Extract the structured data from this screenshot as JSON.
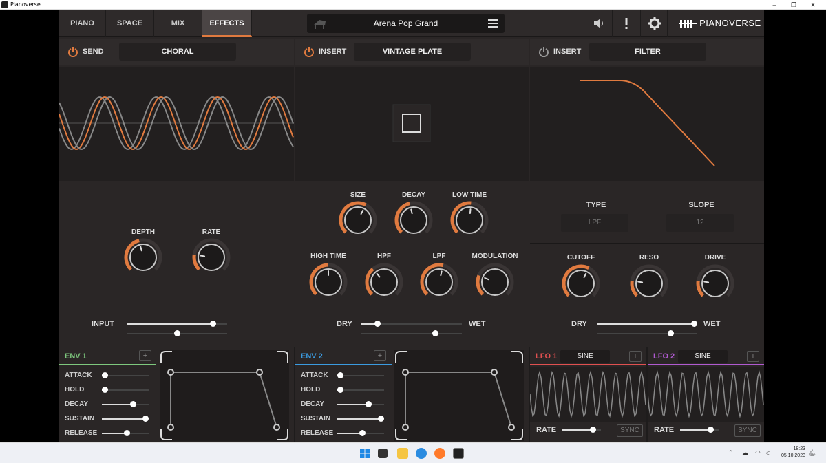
{
  "window": {
    "title": "Pianoverse",
    "controls": [
      "–",
      "❐",
      "✕"
    ]
  },
  "topbar": {
    "tabs": [
      {
        "label": "PIANO",
        "active": false
      },
      {
        "label": "SPACE",
        "active": false
      },
      {
        "label": "MIX",
        "active": false
      },
      {
        "label": "EFFECTS",
        "active": true
      }
    ],
    "preset_name": "Arena Pop Grand",
    "icons": [
      "speaker-icon",
      "alert-icon",
      "gear-icon"
    ],
    "logo": "PIANOVERSE"
  },
  "accent_color": "#e07a3f",
  "panels": {
    "send": {
      "type_label": "SEND",
      "effect": "CHORAL",
      "power_on": true,
      "knobs": [
        {
          "label": "DEPTH",
          "value": 0.45
        },
        {
          "label": "RATE",
          "value": 0.2
        }
      ],
      "slider_label": "INPUT",
      "input_level": 0.88,
      "balance": 0.5
    },
    "insert1": {
      "type_label": "INSERT",
      "effect": "VINTAGE PLATE",
      "power_on": true,
      "knobs_row1": [
        {
          "label": "SIZE",
          "value": 0.6
        },
        {
          "label": "DECAY",
          "value": 0.45
        },
        {
          "label": "LOW TIME",
          "value": 0.52
        }
      ],
      "knobs_row2": [
        {
          "label": "HIGH TIME",
          "value": 0.5
        },
        {
          "label": "HPF",
          "value": 0.35
        },
        {
          "label": "LPF",
          "value": 0.55
        },
        {
          "label": "MODULATION",
          "value": 0.25
        }
      ],
      "dry_label": "DRY",
      "wet_label": "WET",
      "mix": 0.14,
      "balance": 0.75
    },
    "insert2": {
      "type_label": "INSERT",
      "effect": "FILTER",
      "power_on": false,
      "type_title": "TYPE",
      "type_value": "LPF",
      "slope_title": "SLOPE",
      "slope_value": "12",
      "knobs": [
        {
          "label": "CUTOFF",
          "value": 0.6
        },
        {
          "label": "RESO",
          "value": 0.2
        },
        {
          "label": "DRIVE",
          "value": 0.2
        }
      ],
      "dry_label": "DRY",
      "wet_label": "WET",
      "mix": 1.0,
      "balance": 0.75
    }
  },
  "envelopes": [
    {
      "name": "ENV 1",
      "color": "#7ec87e",
      "plus": "+",
      "params": [
        {
          "label": "ATTACK",
          "value": 0.0
        },
        {
          "label": "HOLD",
          "value": 0.0
        },
        {
          "label": "DECAY",
          "value": 0.7
        },
        {
          "label": "SUSTAIN",
          "value": 1.0
        },
        {
          "label": "RELEASE",
          "value": 0.55
        }
      ]
    },
    {
      "name": "ENV 2",
      "color": "#3b9be0",
      "plus": "+",
      "params": [
        {
          "label": "ATTACK",
          "value": 0.0
        },
        {
          "label": "HOLD",
          "value": 0.0
        },
        {
          "label": "DECAY",
          "value": 0.7
        },
        {
          "label": "SUSTAIN",
          "value": 1.0
        },
        {
          "label": "RELEASE",
          "value": 0.55
        }
      ]
    }
  ],
  "lfos": [
    {
      "name": "LFO 1",
      "color": "#e05050",
      "shape": "SINE",
      "plus": "+",
      "rate_label": "RATE",
      "rate": 0.85,
      "sync": "SYNC"
    },
    {
      "name": "LFO 2",
      "color": "#b05ad0",
      "shape": "SINE",
      "plus": "+",
      "rate_label": "RATE",
      "rate": 0.85,
      "sync": "SYNC"
    }
  ],
  "taskbar": {
    "time": "18:23",
    "date": "05.10.2023"
  }
}
